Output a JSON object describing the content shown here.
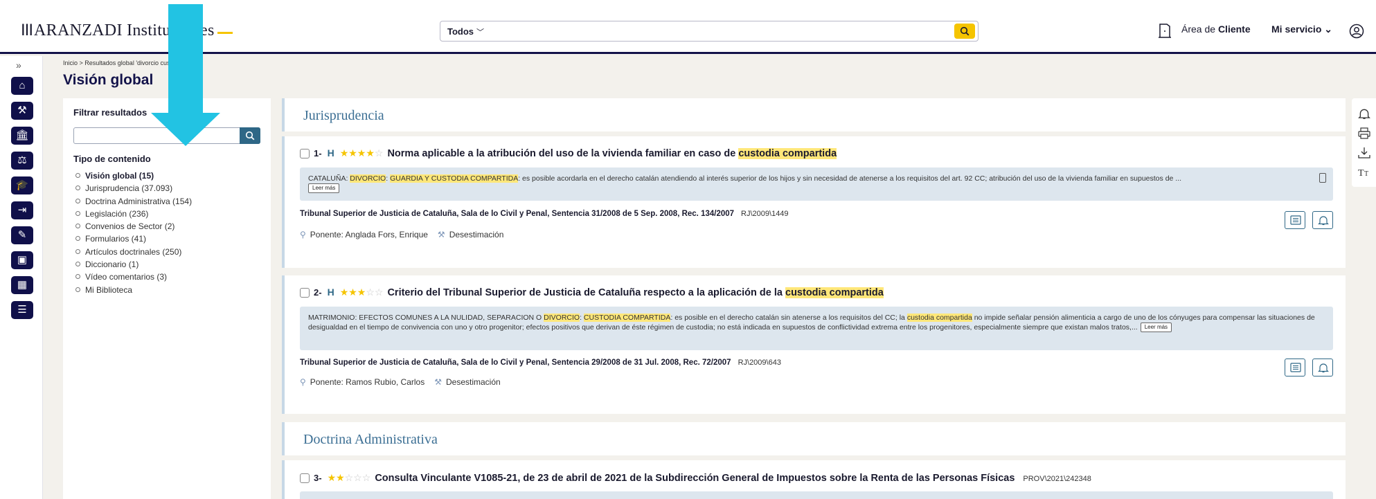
{
  "header": {
    "logo_bars": "III",
    "logo_text": "ARANZADI Instituciones",
    "search_scope": "Todos",
    "area_prefix": "Área de",
    "area_bold": "Cliente",
    "mi_servicio": "Mi servicio"
  },
  "breadcrumb": "Inicio > Resultados global 'divorcio custodia...",
  "page_title": "Visión global",
  "filter": {
    "title": "Filtrar resultados",
    "input_value": "",
    "tipo_title": "Tipo de contenido",
    "items": [
      "Visión global  (15)",
      "Jurisprudencia (37.093)",
      "Doctrina Administrativa (154)",
      "Legislación (236)",
      "Convenios de Sector (2)",
      "Formularios (41)",
      "Artículos doctrinales (250)",
      "Diccionario (1)",
      "Vídeo comentarios (3)",
      "Mi Biblioteca"
    ]
  },
  "sections": {
    "jurisprudencia": "Jurisprudencia",
    "doctrina": "Doctrina Administrativa"
  },
  "results": [
    {
      "num": "1-",
      "badge": "H",
      "stars_filled": 4,
      "title_pre": "Norma aplicable a la atribución del uso de la vivienda familiar en caso de",
      "title_hl": "custodia compartida",
      "summary_pre": "CATALUÑA: ",
      "summary_hl1": "DIVORCIO",
      "summary_mid1": ": ",
      "summary_hl2": "GUARDIA Y CUSTODIA COMPARTIDA",
      "summary_post": ": es posible acordarla en el derecho catalán atendiendo al interés superior de los hijos y sin necesidad de atenerse a los requisitos del art. 92 CC; atribución del uso de la vivienda familiar en supuestos de ...",
      "leer_mas": "Leer más",
      "citation": "Tribunal Superior de Justicia de Cataluña, Sala de lo Civil y Penal, Sentencia 31/2008 de 5 Sep. 2008, Rec. 134/2007",
      "ref": "RJ\\2009\\1449",
      "ponente": "Ponente: Anglada Fors, Enrique",
      "fallo": "Desestimación"
    },
    {
      "num": "2-",
      "badge": "H",
      "stars_filled": 3,
      "title_pre": "Criterio del Tribunal Superior de Justicia de Cataluña respecto a la aplicación de la",
      "title_hl": "custodia compartida",
      "summary_pre": "MATRIMONIO: EFECTOS COMUNES A LA NULIDAD, SEPARACION O ",
      "summary_hl1": "DIVORCIO",
      "summary_mid1": ": ",
      "summary_hl2": "CUSTODIA COMPARTIDA",
      "summary_mid2": ": es posible en el derecho catalán sin atenerse a los requisitos del CC; la ",
      "summary_hl3": "custodia compartida",
      "summary_post": " no impide señalar pensión alimenticia a cargo de uno de los cónyuges para compensar las situaciones de desigualdad en el tiempo de convivencia con uno y otro progenitor; efectos positivos que derivan de éste régimen de custodia; no está indicada en supuestos de conflictividad extrema entre los progenitores, especialmente siempre que existan malos tratos,...",
      "leer_mas": "Leer más",
      "citation": "Tribunal Superior de Justicia de Cataluña, Sala de lo Civil y Penal, Sentencia 29/2008 de 31 Jul. 2008, Rec. 72/2007",
      "ref": "RJ\\2009\\643",
      "ponente": "Ponente: Ramos Rubio, Carlos",
      "fallo": "Desestimación"
    },
    {
      "num": "3-",
      "stars_filled": 2,
      "title": "Consulta Vinculante V1085-21, de 23 de abril de 2021 de la Subdirección General de Impuestos sobre la Renta de las Personas Físicas",
      "ref": "PROV\\2021\\242348"
    }
  ],
  "colors": {
    "navy": "#13134a",
    "accent_yellow": "#f5c400",
    "highlight": "#ffe779",
    "section_blue": "#3c6f94",
    "overlay_arrow": "#22c3e3"
  }
}
